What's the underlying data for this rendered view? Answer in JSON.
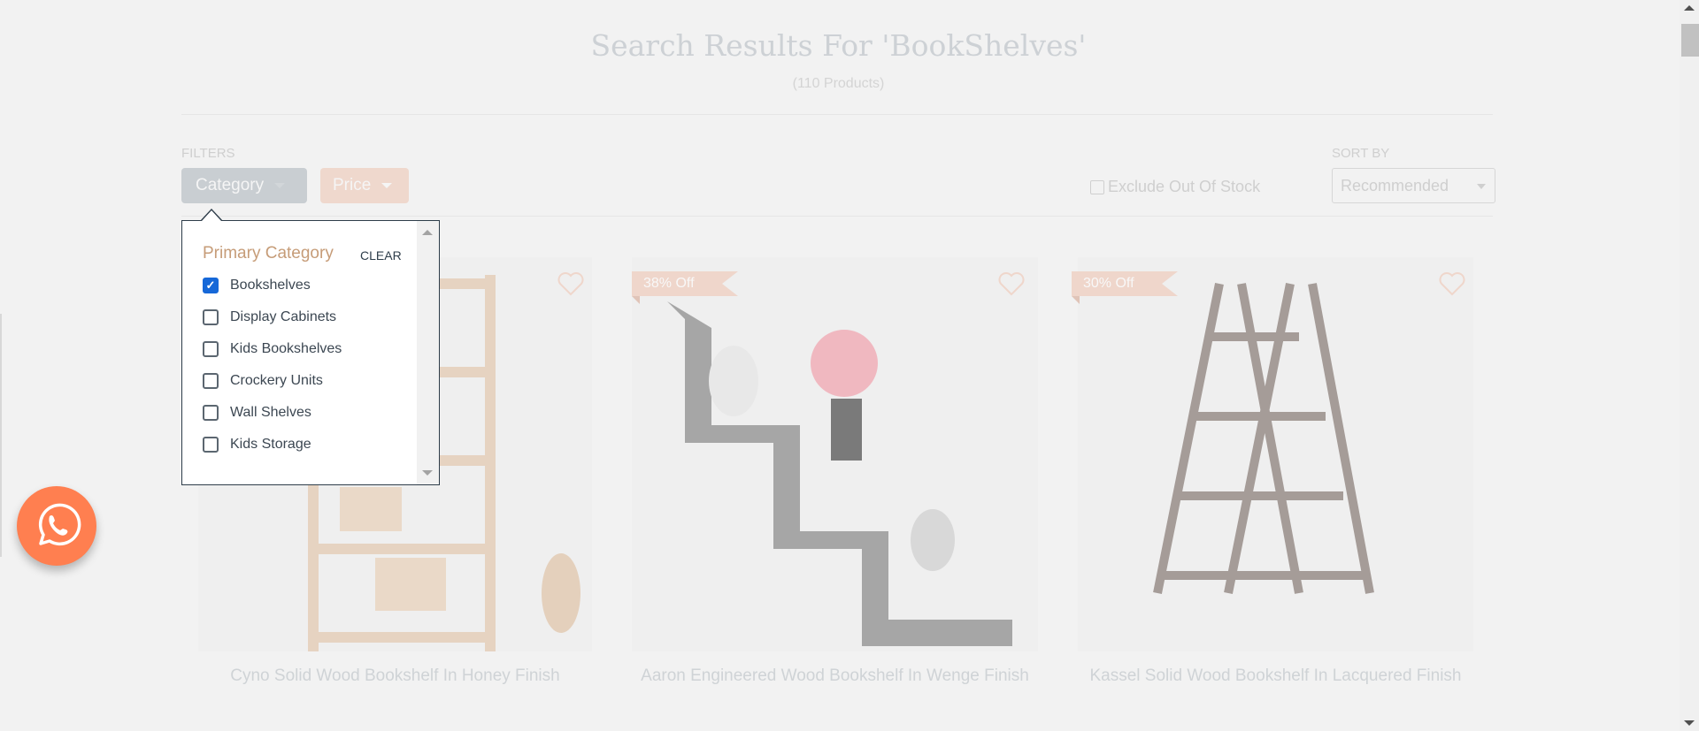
{
  "header": {
    "title": "Search Results For 'BookShelves'",
    "count": "(110 Products)"
  },
  "filters": {
    "label": "FILTERS",
    "category_button": "Category",
    "price_button": "Price",
    "exclude_out_of_stock": "Exclude Out Of Stock",
    "exclude_checked": false
  },
  "sort": {
    "label": "SORT BY",
    "selected": "Recommended"
  },
  "category_popup": {
    "heading": "Primary Category",
    "clear": "CLEAR",
    "options": [
      {
        "label": "Bookshelves",
        "checked": true
      },
      {
        "label": "Display Cabinets",
        "checked": false
      },
      {
        "label": "Kids Bookshelves",
        "checked": false
      },
      {
        "label": "Crockery Units",
        "checked": false
      },
      {
        "label": "Wall Shelves",
        "checked": false
      },
      {
        "label": "Kids Storage",
        "checked": false
      }
    ]
  },
  "products": [
    {
      "title": "Cyno Solid Wood Bookshelf In Honey Finish",
      "badge": null
    },
    {
      "title": "Aaron Engineered Wood Bookshelf In Wenge Finish",
      "badge": "38% Off"
    },
    {
      "title": "Kassel Solid Wood Bookshelf In Lacquered Finish",
      "badge": "30% Off"
    }
  ],
  "colors": {
    "accent": "#ff7f50",
    "checkbox": "#1668d8",
    "heading": "#c69c78"
  },
  "check_mark": "✓"
}
